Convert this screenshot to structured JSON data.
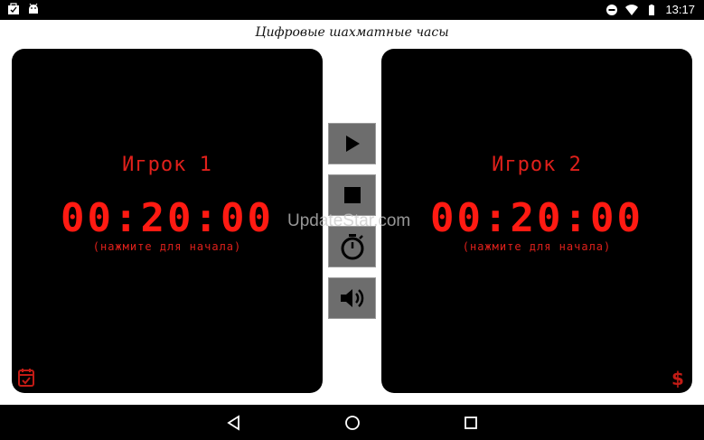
{
  "status_bar": {
    "time": "13:17",
    "icons": [
      "briefcase-icon",
      "android-icon",
      "do-not-disturb-icon",
      "wifi-icon",
      "battery-icon"
    ]
  },
  "app": {
    "title": "Цифровые шахматные часы"
  },
  "player1": {
    "name": "Игрок 1",
    "time": "00:20:00",
    "hint": "(нажмите для начала)",
    "corner_icon": "calendar-check-icon"
  },
  "player2": {
    "name": "Игрок 2",
    "time": "00:20:00",
    "hint": "(нажмите для начала)",
    "corner_icon": "dollar-icon"
  },
  "controls": [
    {
      "name": "play-button",
      "icon": "play-icon"
    },
    {
      "name": "stop-button",
      "icon": "stop-icon"
    },
    {
      "name": "timer-button",
      "icon": "stopwatch-icon"
    },
    {
      "name": "sound-button",
      "icon": "volume-icon"
    }
  ],
  "watermark": "UpdateStar.com",
  "nav_bar": {
    "icons": [
      "back-icon",
      "home-icon",
      "recent-apps-icon"
    ]
  },
  "colors": {
    "digit_red": "#ff1a12",
    "label_red": "#e0201b",
    "panel_bg": "#000000",
    "button_gray": "#6d6d6d"
  }
}
